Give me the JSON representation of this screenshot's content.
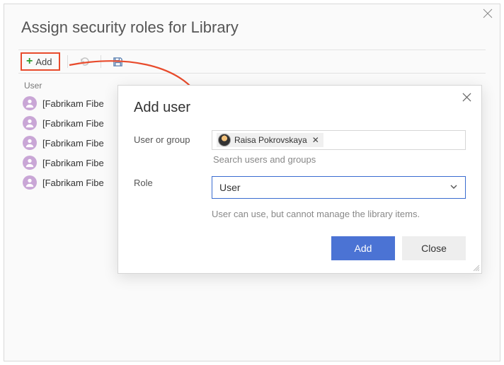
{
  "page": {
    "title": "Assign security roles for Library"
  },
  "toolbar": {
    "add_label": "Add"
  },
  "table": {
    "column_user": "User",
    "rows": [
      {
        "name": "[Fabrikam Fibe"
      },
      {
        "name": "[Fabrikam Fibe"
      },
      {
        "name": "[Fabrikam Fibe"
      },
      {
        "name": "[Fabrikam Fibe"
      },
      {
        "name": "[Fabrikam Fibe"
      }
    ]
  },
  "dialog": {
    "title": "Add user",
    "user_label": "User or group",
    "role_label": "Role",
    "search_placeholder": "Search users and groups",
    "selected_user": "Raisa Pokrovskaya",
    "role_value": "User",
    "role_desc": "User can use, but cannot manage the library items.",
    "add_button": "Add",
    "close_button": "Close"
  }
}
